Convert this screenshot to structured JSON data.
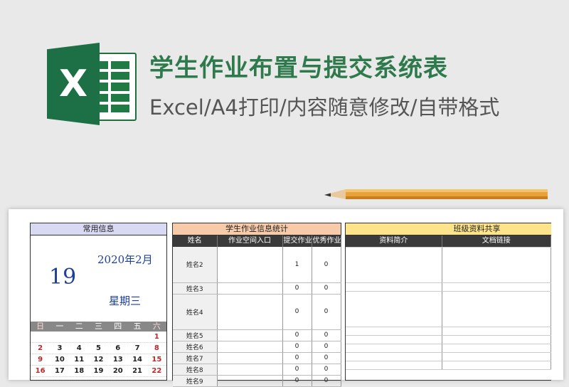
{
  "banner": {
    "logo_letter": "X",
    "title": "学生作业布置与提交系统表",
    "subtitle": "Excel/A4打印/内容随意修改/自带格式"
  },
  "colors": {
    "brand_green": "#1d7045",
    "title_green": "#2e7a4d",
    "calendar_blue": "#1c3f9c",
    "weekend_red": "#c0262c"
  },
  "common": {
    "header": "常用信息",
    "month": "2020年2月",
    "day": "19",
    "weekday": "星期三",
    "week_headers": [
      "日",
      "一",
      "二",
      "三",
      "四",
      "五",
      "六"
    ],
    "weeks": [
      [
        "",
        "",
        "",
        "",
        "",
        "",
        "1"
      ],
      [
        "2",
        "3",
        "4",
        "5",
        "6",
        "7",
        "8"
      ],
      [
        "9",
        "10",
        "11",
        "12",
        "13",
        "14",
        "15"
      ],
      [
        "16",
        "17",
        "18",
        "19",
        "20",
        "21",
        "22"
      ]
    ]
  },
  "stats": {
    "header": "学生作业信息统计",
    "columns": [
      "姓名",
      "作业空间入口",
      "提交作业",
      "优秀作业"
    ],
    "rows": [
      {
        "name": "姓名2",
        "submitted": "1",
        "excellent": "0"
      },
      {
        "name": "姓名3",
        "submitted": "0",
        "excellent": "0"
      },
      {
        "name": "姓名4",
        "submitted": "0",
        "excellent": "0"
      },
      {
        "name": "姓名5",
        "submitted": "0",
        "excellent": "0"
      },
      {
        "name": "姓名6",
        "submitted": "0",
        "excellent": "0"
      },
      {
        "name": "姓名7",
        "submitted": "0",
        "excellent": "0"
      },
      {
        "name": "姓名8",
        "submitted": "0",
        "excellent": "0"
      },
      {
        "name": "姓名9",
        "submitted": "0",
        "excellent": "0"
      }
    ]
  },
  "share": {
    "header": "班级资料共享",
    "columns": [
      "资料简介",
      "文档链接"
    ]
  }
}
